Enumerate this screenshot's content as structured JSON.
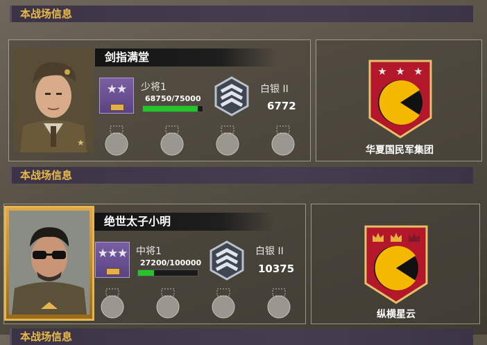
{
  "sections": [
    {
      "header": "本战场信息",
      "player": {
        "name": "剑指满堂",
        "rank": "少将1",
        "xp_text": "68750/75000",
        "xp_progress": 0.9167,
        "tier": "白银 II",
        "tier_score": "6772"
      },
      "guild": {
        "name": "华夏国民军集团"
      }
    },
    {
      "header": "本战场信息",
      "player": {
        "name": "绝世太子小明",
        "rank": "中将1",
        "xp_text": "27200/100000",
        "xp_progress": 0.272,
        "tier": "白银 II",
        "tier_score": "10375"
      },
      "guild": {
        "name": "纵横星云"
      }
    },
    {
      "header": "本战场信息"
    }
  ],
  "colors": {
    "header_text": "#e8b94a",
    "xp_fill": "#25c42b",
    "rank_badge": "#6a5092",
    "banner_red": "#b3182a",
    "pacman_yellow": "#f5b800"
  },
  "icons": {
    "rank_stars_1": "★★",
    "rank_stars_2": "★★★",
    "guild1_crown_icons": "star-icons",
    "guild2_crown_icons": "crown-icons"
  }
}
